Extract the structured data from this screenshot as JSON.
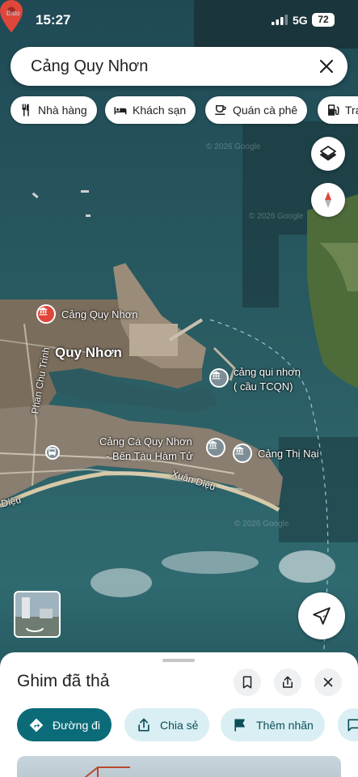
{
  "status_bar": {
    "time": "15:27",
    "network": "5G",
    "battery": "72",
    "brand_text": "Bato"
  },
  "search": {
    "query": "Cảng Quy Nhơn"
  },
  "chips": [
    {
      "label": "Nhà hàng",
      "icon": "restaurant-icon"
    },
    {
      "label": "Khách sạn",
      "icon": "hotel-icon"
    },
    {
      "label": "Quán cà phê",
      "icon": "coffee-icon"
    },
    {
      "label": "Trạ",
      "icon": "gas-station-icon"
    }
  ],
  "map": {
    "labels": {
      "city": "Quy Nhơn",
      "poi_cang_quy_nhon": "Cảng Quy Nhơn",
      "poi_cang_qui_nhon_line1": "cảng qui nhơn",
      "poi_cang_qui_nhon_line2": "( cầu TCQN)",
      "poi_cang_ca_line1": "Cảng Cá Quy Nhơn",
      "poi_cang_ca_line2": "- Bến Tàu Hàm Tử",
      "poi_cang_thi_nai": "Cảng Thị Nại",
      "street_phan_chu_trinh": "Phan Chu Trinh",
      "street_xuan_dieu": "Xuân Diệu",
      "street_dieu": "Diệu"
    },
    "watermarks": [
      "© 2026 Google",
      "© 2026 Google",
      "© 2026 Google"
    ]
  },
  "sheet": {
    "title": "Ghim đã thả",
    "actions": [
      {
        "label": "Đường đi",
        "icon": "directions-icon"
      },
      {
        "label": "Chia sẻ",
        "icon": "share-icon"
      },
      {
        "label": "Thêm nhãn",
        "icon": "label-flag-icon"
      }
    ]
  },
  "colors": {
    "accent": "#0b6b78",
    "accent_light": "#d9eff3",
    "pin": "#e0463a"
  }
}
